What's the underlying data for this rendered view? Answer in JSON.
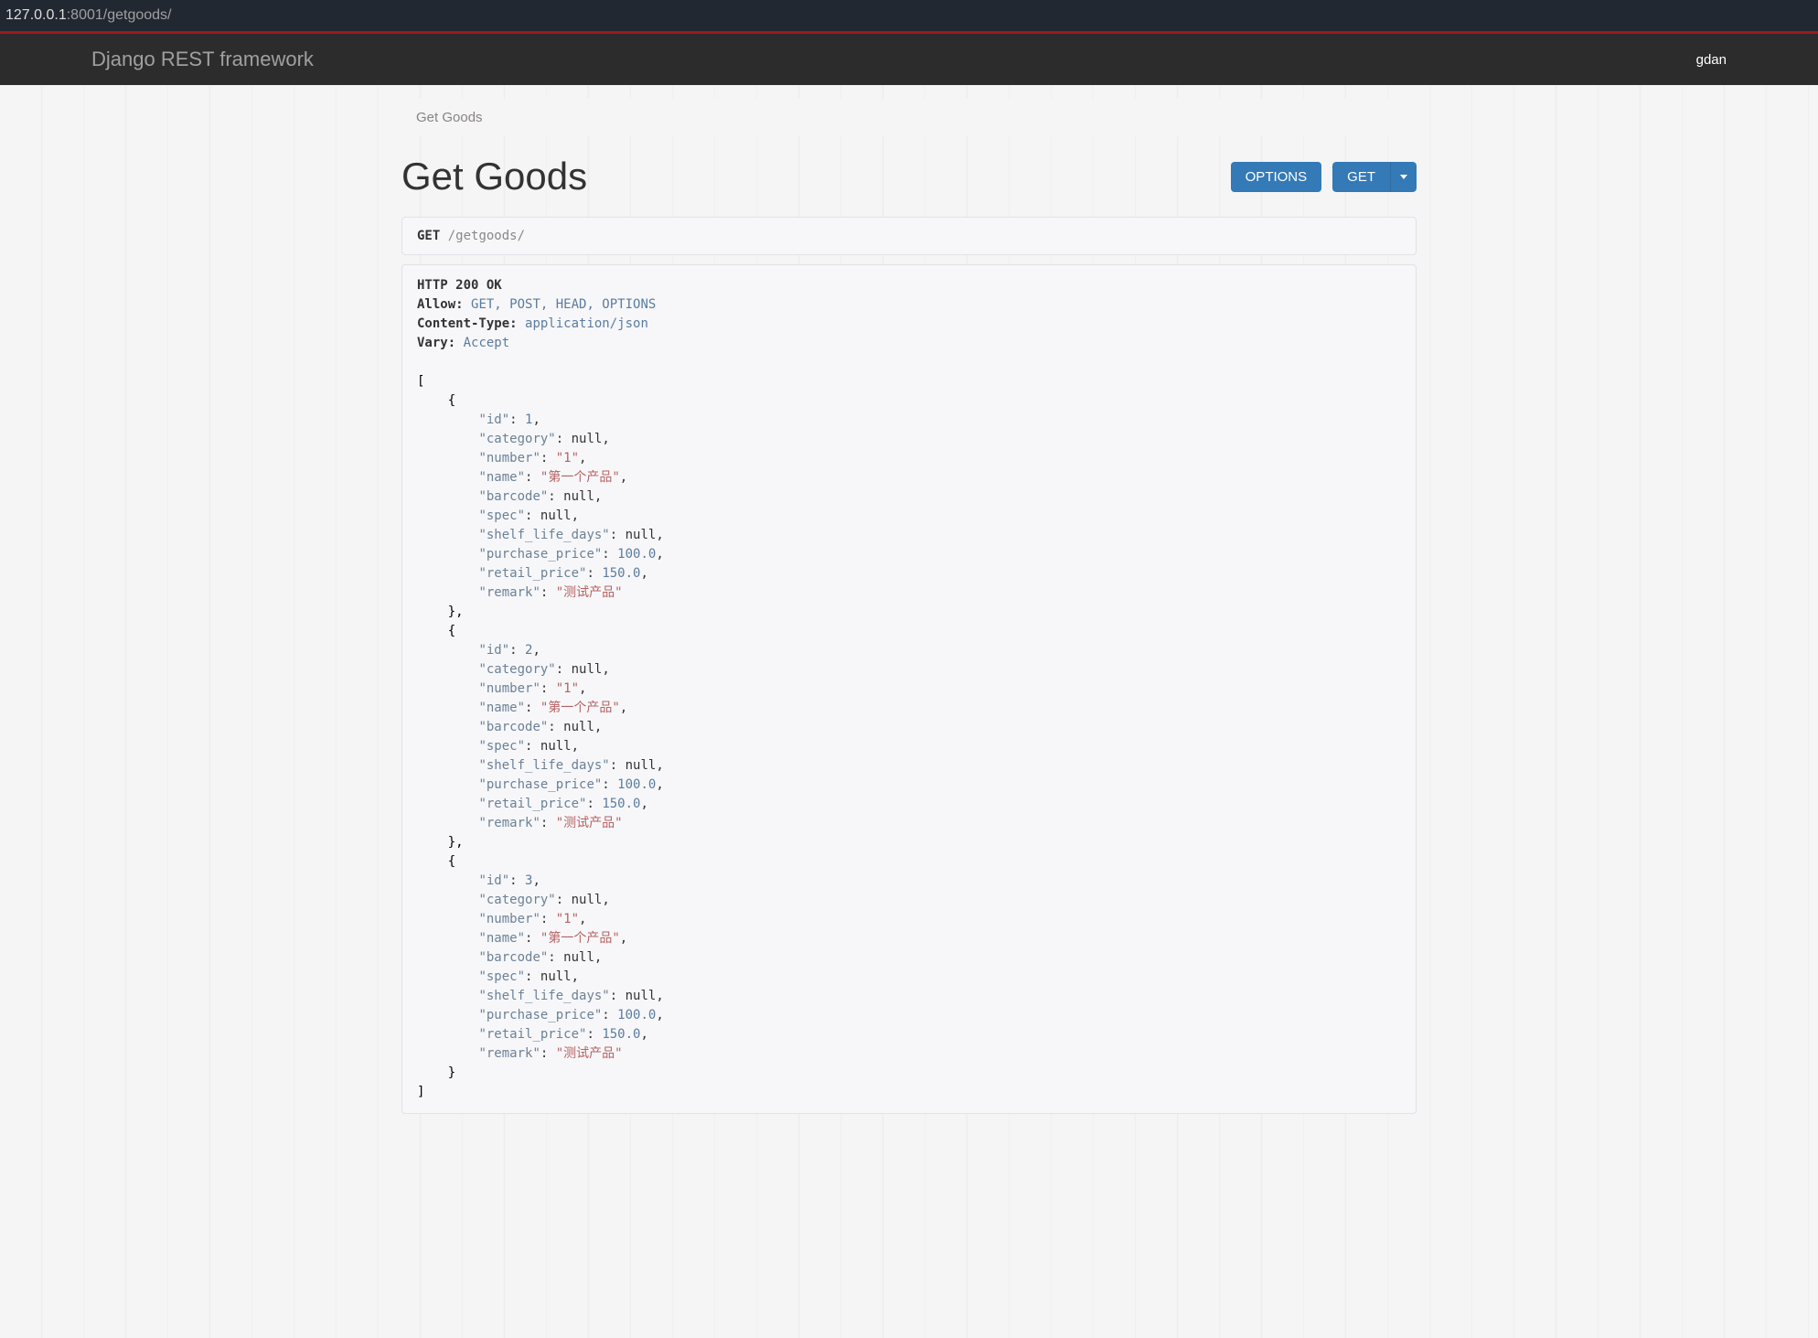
{
  "browser": {
    "host": "127.0.0.1",
    "path": ":8001/getgoods/"
  },
  "navbar": {
    "brand": "Django REST framework",
    "user": "gdan"
  },
  "breadcrumb": {
    "label": "Get Goods"
  },
  "page_title": "Get Goods",
  "buttons": {
    "options_label": "OPTIONS",
    "get_label": "GET"
  },
  "request": {
    "method": "GET",
    "path": "/getgoods/"
  },
  "response": {
    "status": "HTTP 200 OK",
    "headers": {
      "allow_key": "Allow:",
      "allow_value": "GET, POST, HEAD, OPTIONS",
      "content_type_key": "Content-Type:",
      "content_type_value": "application/json",
      "vary_key": "Vary:",
      "vary_value": "Accept"
    },
    "body": [
      {
        "id": 1,
        "category": null,
        "number": "1",
        "name": "第一个产品",
        "barcode": null,
        "spec": null,
        "shelf_life_days": null,
        "purchase_price": 100.0,
        "retail_price": 150.0,
        "remark": "测试产品"
      },
      {
        "id": 2,
        "category": null,
        "number": "1",
        "name": "第一个产品",
        "barcode": null,
        "spec": null,
        "shelf_life_days": null,
        "purchase_price": 100.0,
        "retail_price": 150.0,
        "remark": "测试产品"
      },
      {
        "id": 3,
        "category": null,
        "number": "1",
        "name": "第一个产品",
        "barcode": null,
        "spec": null,
        "shelf_life_days": null,
        "purchase_price": 100.0,
        "retail_price": 150.0,
        "remark": "测试产品"
      }
    ]
  }
}
